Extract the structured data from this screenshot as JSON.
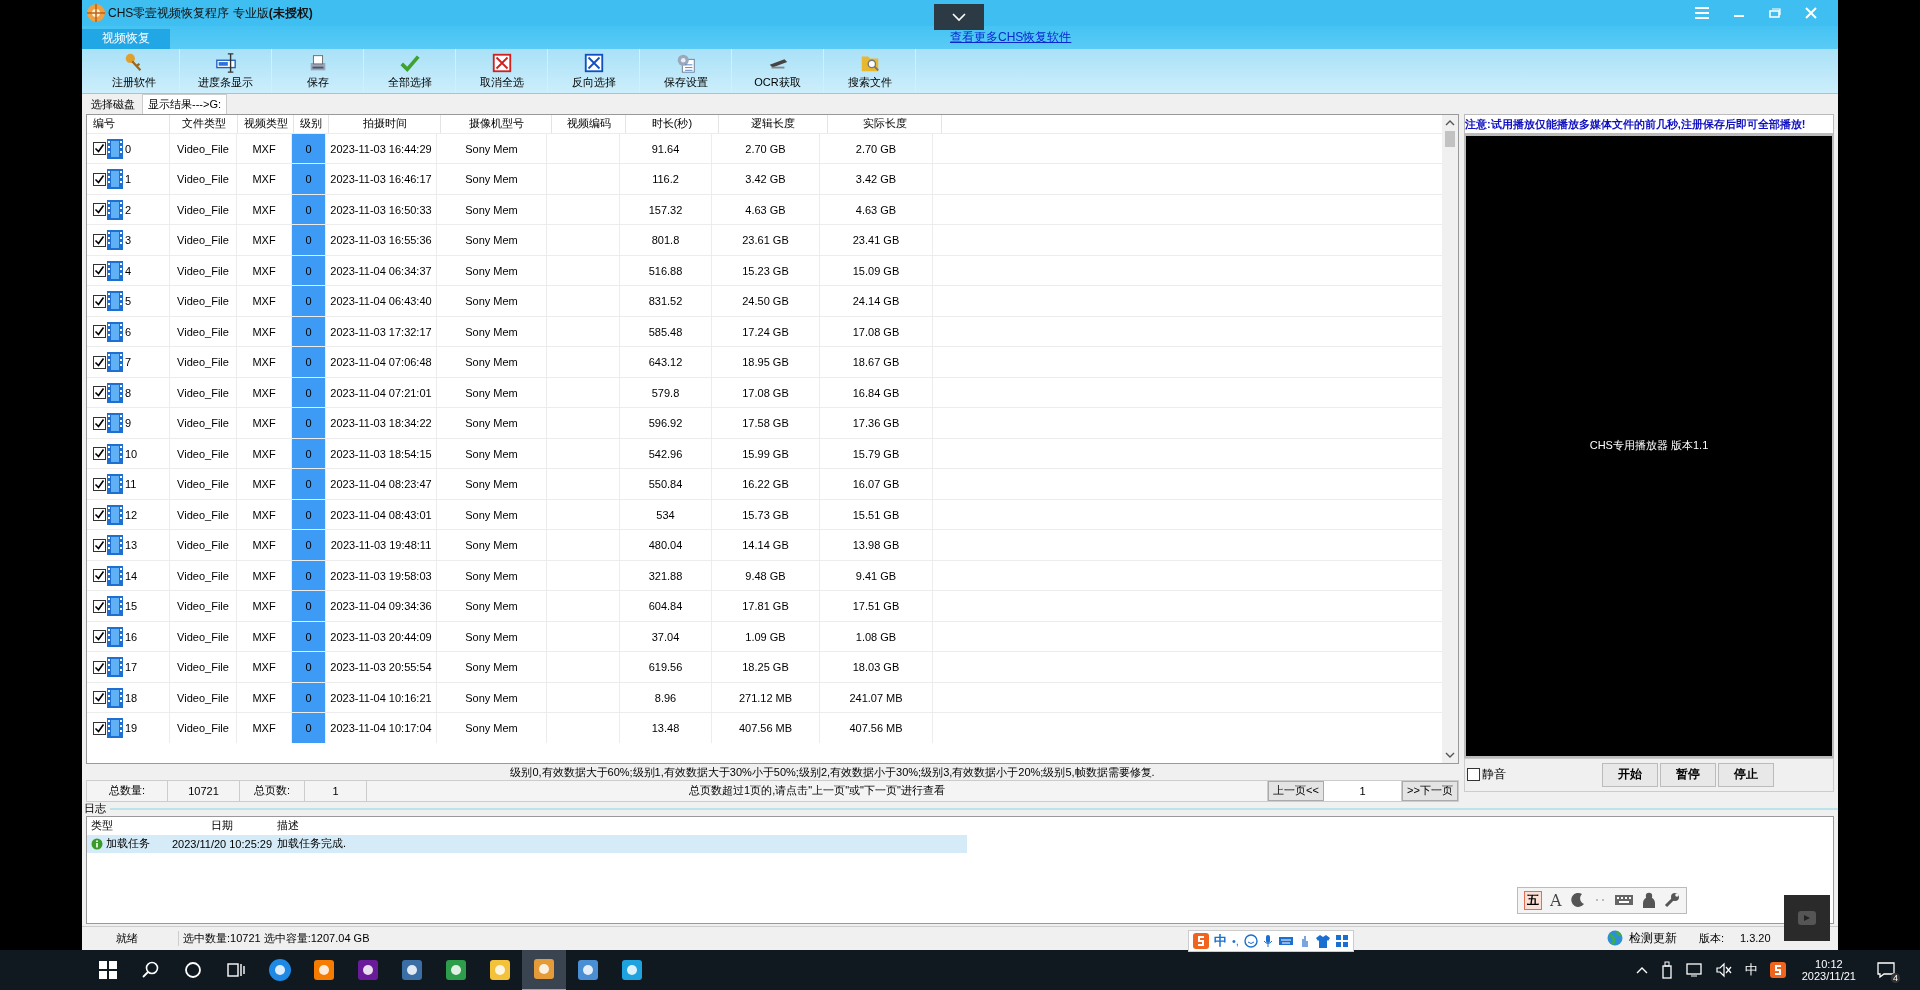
{
  "window": {
    "title": "CHS零壹视频恢复程序 专业版**(未授权)**"
  },
  "main_tab": {
    "label": "视频恢复",
    "selected": true
  },
  "more_link": "查看更多CHS恢复软件",
  "toolbar": [
    "注册软件",
    "进度条显示",
    "保存",
    "全部选择",
    "取消全选",
    "反向选择",
    "保存设置",
    "OCR获取",
    "搜索文件"
  ],
  "tabs": [
    {
      "label": "选择磁盘",
      "selected": false
    },
    {
      "label": "显示结果--->G:",
      "selected": true
    }
  ],
  "table": {
    "columns": [
      "编号",
      "文件类型",
      "视频类型",
      "级别",
      "拍摄时间",
      "摄像机型号",
      "视频编码",
      "时长(秒)",
      "逻辑长度",
      "实际长度"
    ],
    "rows": [
      {
        "checked": true,
        "cells": [
          "0",
          "Video_File",
          "MXF",
          "0",
          "2023-11-03 16:44:29",
          "Sony Mem",
          "",
          "91.64",
          "2.70 GB",
          "2.70 GB"
        ]
      },
      {
        "checked": true,
        "cells": [
          "1",
          "Video_File",
          "MXF",
          "0",
          "2023-11-03 16:46:17",
          "Sony Mem",
          "",
          "116.2",
          "3.42 GB",
          "3.42 GB"
        ]
      },
      {
        "checked": true,
        "cells": [
          "2",
          "Video_File",
          "MXF",
          "0",
          "2023-11-03 16:50:33",
          "Sony Mem",
          "",
          "157.32",
          "4.63 GB",
          "4.63 GB"
        ]
      },
      {
        "checked": true,
        "cells": [
          "3",
          "Video_File",
          "MXF",
          "0",
          "2023-11-03 16:55:36",
          "Sony Mem",
          "",
          "801.8",
          "23.61 GB",
          "23.41 GB"
        ]
      },
      {
        "checked": true,
        "cells": [
          "4",
          "Video_File",
          "MXF",
          "0",
          "2023-11-04 06:34:37",
          "Sony Mem",
          "",
          "516.88",
          "15.23 GB",
          "15.09 GB"
        ]
      },
      {
        "checked": true,
        "cells": [
          "5",
          "Video_File",
          "MXF",
          "0",
          "2023-11-04 06:43:40",
          "Sony Mem",
          "",
          "831.52",
          "24.50 GB",
          "24.14 GB"
        ]
      },
      {
        "checked": true,
        "cells": [
          "6",
          "Video_File",
          "MXF",
          "0",
          "2023-11-03 17:32:17",
          "Sony Mem",
          "",
          "585.48",
          "17.24 GB",
          "17.08 GB"
        ]
      },
      {
        "checked": true,
        "cells": [
          "7",
          "Video_File",
          "MXF",
          "0",
          "2023-11-04 07:06:48",
          "Sony Mem",
          "",
          "643.12",
          "18.95 GB",
          "18.67 GB"
        ]
      },
      {
        "checked": true,
        "cells": [
          "8",
          "Video_File",
          "MXF",
          "0",
          "2023-11-04 07:21:01",
          "Sony Mem",
          "",
          "579.8",
          "17.08 GB",
          "16.84 GB"
        ]
      },
      {
        "checked": true,
        "cells": [
          "9",
          "Video_File",
          "MXF",
          "0",
          "2023-11-03 18:34:22",
          "Sony Mem",
          "",
          "596.92",
          "17.58 GB",
          "17.36 GB"
        ]
      },
      {
        "checked": true,
        "cells": [
          "10",
          "Video_File",
          "MXF",
          "0",
          "2023-11-03 18:54:15",
          "Sony Mem",
          "",
          "542.96",
          "15.99 GB",
          "15.79 GB"
        ]
      },
      {
        "checked": true,
        "cells": [
          "11",
          "Video_File",
          "MXF",
          "0",
          "2023-11-04 08:23:47",
          "Sony Mem",
          "",
          "550.84",
          "16.22 GB",
          "16.07 GB"
        ]
      },
      {
        "checked": true,
        "cells": [
          "12",
          "Video_File",
          "MXF",
          "0",
          "2023-11-04 08:43:01",
          "Sony Mem",
          "",
          "534",
          "15.73 GB",
          "15.51 GB"
        ]
      },
      {
        "checked": true,
        "cells": [
          "13",
          "Video_File",
          "MXF",
          "0",
          "2023-11-03 19:48:11",
          "Sony Mem",
          "",
          "480.04",
          "14.14 GB",
          "13.98 GB"
        ]
      },
      {
        "checked": true,
        "cells": [
          "14",
          "Video_File",
          "MXF",
          "0",
          "2023-11-03 19:58:03",
          "Sony Mem",
          "",
          "321.88",
          "9.48 GB",
          "9.41 GB"
        ]
      },
      {
        "checked": true,
        "cells": [
          "15",
          "Video_File",
          "MXF",
          "0",
          "2023-11-04 09:34:36",
          "Sony Mem",
          "",
          "604.84",
          "17.81 GB",
          "17.51 GB"
        ]
      },
      {
        "checked": true,
        "cells": [
          "16",
          "Video_File",
          "MXF",
          "0",
          "2023-11-03 20:44:09",
          "Sony Mem",
          "",
          "37.04",
          "1.09 GB",
          "1.08 GB"
        ]
      },
      {
        "checked": true,
        "cells": [
          "17",
          "Video_File",
          "MXF",
          "0",
          "2023-11-03 20:55:54",
          "Sony Mem",
          "",
          "619.56",
          "18.25 GB",
          "18.03 GB"
        ]
      },
      {
        "checked": true,
        "cells": [
          "18",
          "Video_File",
          "MXF",
          "0",
          "2023-11-04 10:16:21",
          "Sony Mem",
          "",
          "8.96",
          "271.12 MB",
          "241.07 MB"
        ]
      },
      {
        "checked": true,
        "cells": [
          "19",
          "Video_File",
          "MXF",
          "0",
          "2023-11-04 10:17:04",
          "Sony Mem",
          "",
          "13.48",
          "407.56 MB",
          "407.56 MB"
        ]
      }
    ]
  },
  "legend": "级别0,有效数据大于60%;级别1,有效数据大于30%小于50%;级别2,有效数据小于30%;级别3,有效数据小于20%;级别5,帧数据需要修复.",
  "pager": {
    "total_label": "总数量:",
    "total": "10721",
    "pages_label": "总页数:",
    "pages": "1",
    "hint": "总页数超过1页的,请点击\"上一页\"或\"下一页\"进行查看",
    "prev": "上一页<<",
    "page": "1",
    "next": ">>下一页"
  },
  "player": {
    "notice": "注意:试用播放仅能播放多媒体文件的前几秒,注册保存后即可全部播放!",
    "screen_text": "CHS专用播放器 版本1.1",
    "mute": {
      "label": "静音",
      "checked": false
    },
    "buttons": [
      "开始",
      "暂停",
      "停止"
    ]
  },
  "log": {
    "title": "日志",
    "columns": [
      "类型",
      "日期",
      "描述"
    ],
    "rows": [
      {
        "selected": true,
        "type": "加载任务",
        "date": "2023/11/20 10:25:29",
        "description": "加载任务完成."
      }
    ]
  },
  "ime_toolbar": {
    "mode": "五",
    "font": "A"
  },
  "ime_bar": {
    "mode": "中",
    "punct": "•,"
  },
  "status_bar": {
    "state": "就绪",
    "selection": "选中数量:10721 选中容量:1207.04 GB",
    "update": "检测更新",
    "version_label": "版本:",
    "version": "1.3.20"
  },
  "taskbar": {
    "ime": "中",
    "time": "10:12",
    "date": "2023/11/21",
    "notifications": "4"
  }
}
